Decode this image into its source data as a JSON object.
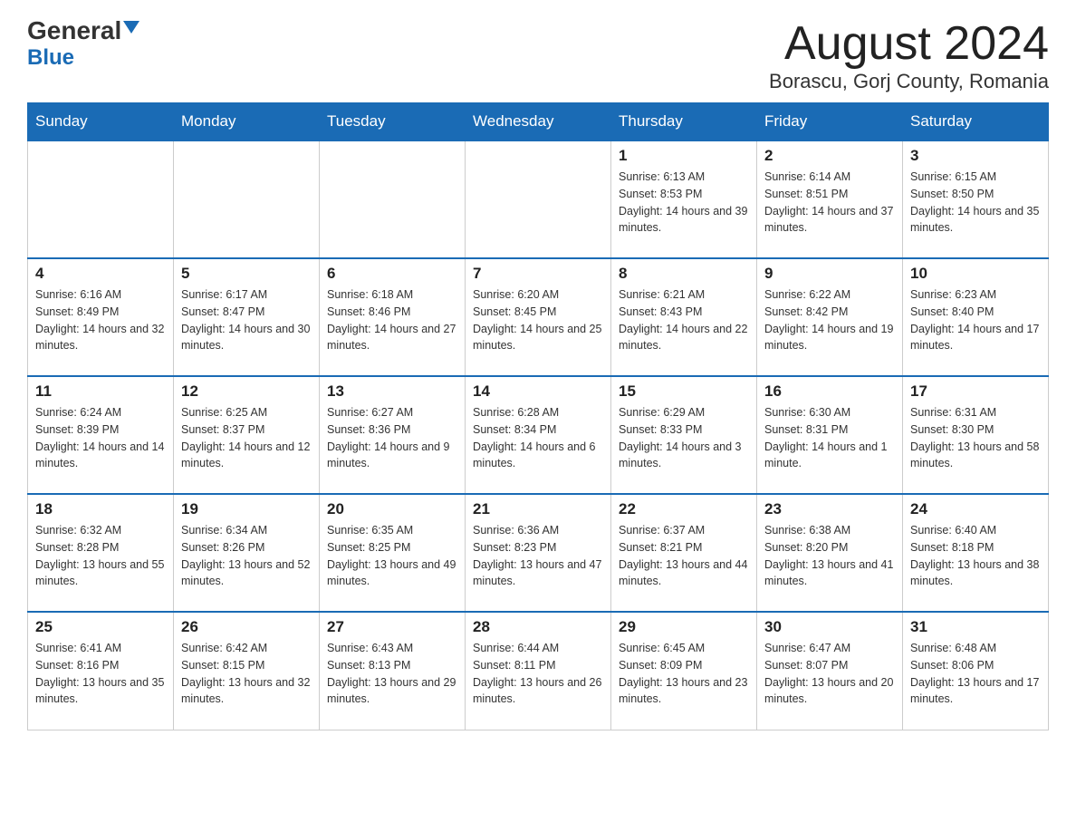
{
  "logo": {
    "general": "General",
    "blue": "Blue"
  },
  "title": {
    "month": "August 2024",
    "location": "Borascu, Gorj County, Romania"
  },
  "days_of_week": [
    "Sunday",
    "Monday",
    "Tuesday",
    "Wednesday",
    "Thursday",
    "Friday",
    "Saturday"
  ],
  "weeks": [
    [
      {
        "day": "",
        "info": ""
      },
      {
        "day": "",
        "info": ""
      },
      {
        "day": "",
        "info": ""
      },
      {
        "day": "",
        "info": ""
      },
      {
        "day": "1",
        "info": "Sunrise: 6:13 AM\nSunset: 8:53 PM\nDaylight: 14 hours and 39 minutes."
      },
      {
        "day": "2",
        "info": "Sunrise: 6:14 AM\nSunset: 8:51 PM\nDaylight: 14 hours and 37 minutes."
      },
      {
        "day": "3",
        "info": "Sunrise: 6:15 AM\nSunset: 8:50 PM\nDaylight: 14 hours and 35 minutes."
      }
    ],
    [
      {
        "day": "4",
        "info": "Sunrise: 6:16 AM\nSunset: 8:49 PM\nDaylight: 14 hours and 32 minutes."
      },
      {
        "day": "5",
        "info": "Sunrise: 6:17 AM\nSunset: 8:47 PM\nDaylight: 14 hours and 30 minutes."
      },
      {
        "day": "6",
        "info": "Sunrise: 6:18 AM\nSunset: 8:46 PM\nDaylight: 14 hours and 27 minutes."
      },
      {
        "day": "7",
        "info": "Sunrise: 6:20 AM\nSunset: 8:45 PM\nDaylight: 14 hours and 25 minutes."
      },
      {
        "day": "8",
        "info": "Sunrise: 6:21 AM\nSunset: 8:43 PM\nDaylight: 14 hours and 22 minutes."
      },
      {
        "day": "9",
        "info": "Sunrise: 6:22 AM\nSunset: 8:42 PM\nDaylight: 14 hours and 19 minutes."
      },
      {
        "day": "10",
        "info": "Sunrise: 6:23 AM\nSunset: 8:40 PM\nDaylight: 14 hours and 17 minutes."
      }
    ],
    [
      {
        "day": "11",
        "info": "Sunrise: 6:24 AM\nSunset: 8:39 PM\nDaylight: 14 hours and 14 minutes."
      },
      {
        "day": "12",
        "info": "Sunrise: 6:25 AM\nSunset: 8:37 PM\nDaylight: 14 hours and 12 minutes."
      },
      {
        "day": "13",
        "info": "Sunrise: 6:27 AM\nSunset: 8:36 PM\nDaylight: 14 hours and 9 minutes."
      },
      {
        "day": "14",
        "info": "Sunrise: 6:28 AM\nSunset: 8:34 PM\nDaylight: 14 hours and 6 minutes."
      },
      {
        "day": "15",
        "info": "Sunrise: 6:29 AM\nSunset: 8:33 PM\nDaylight: 14 hours and 3 minutes."
      },
      {
        "day": "16",
        "info": "Sunrise: 6:30 AM\nSunset: 8:31 PM\nDaylight: 14 hours and 1 minute."
      },
      {
        "day": "17",
        "info": "Sunrise: 6:31 AM\nSunset: 8:30 PM\nDaylight: 13 hours and 58 minutes."
      }
    ],
    [
      {
        "day": "18",
        "info": "Sunrise: 6:32 AM\nSunset: 8:28 PM\nDaylight: 13 hours and 55 minutes."
      },
      {
        "day": "19",
        "info": "Sunrise: 6:34 AM\nSunset: 8:26 PM\nDaylight: 13 hours and 52 minutes."
      },
      {
        "day": "20",
        "info": "Sunrise: 6:35 AM\nSunset: 8:25 PM\nDaylight: 13 hours and 49 minutes."
      },
      {
        "day": "21",
        "info": "Sunrise: 6:36 AM\nSunset: 8:23 PM\nDaylight: 13 hours and 47 minutes."
      },
      {
        "day": "22",
        "info": "Sunrise: 6:37 AM\nSunset: 8:21 PM\nDaylight: 13 hours and 44 minutes."
      },
      {
        "day": "23",
        "info": "Sunrise: 6:38 AM\nSunset: 8:20 PM\nDaylight: 13 hours and 41 minutes."
      },
      {
        "day": "24",
        "info": "Sunrise: 6:40 AM\nSunset: 8:18 PM\nDaylight: 13 hours and 38 minutes."
      }
    ],
    [
      {
        "day": "25",
        "info": "Sunrise: 6:41 AM\nSunset: 8:16 PM\nDaylight: 13 hours and 35 minutes."
      },
      {
        "day": "26",
        "info": "Sunrise: 6:42 AM\nSunset: 8:15 PM\nDaylight: 13 hours and 32 minutes."
      },
      {
        "day": "27",
        "info": "Sunrise: 6:43 AM\nSunset: 8:13 PM\nDaylight: 13 hours and 29 minutes."
      },
      {
        "day": "28",
        "info": "Sunrise: 6:44 AM\nSunset: 8:11 PM\nDaylight: 13 hours and 26 minutes."
      },
      {
        "day": "29",
        "info": "Sunrise: 6:45 AM\nSunset: 8:09 PM\nDaylight: 13 hours and 23 minutes."
      },
      {
        "day": "30",
        "info": "Sunrise: 6:47 AM\nSunset: 8:07 PM\nDaylight: 13 hours and 20 minutes."
      },
      {
        "day": "31",
        "info": "Sunrise: 6:48 AM\nSunset: 8:06 PM\nDaylight: 13 hours and 17 minutes."
      }
    ]
  ]
}
